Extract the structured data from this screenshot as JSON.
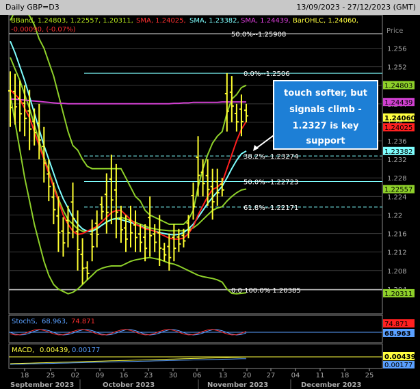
{
  "header": {
    "symbol": "Daily GBP=D3",
    "range": "13/09/2023 - 27/12/2023 (GMT)"
  },
  "legend": {
    "bband": "BBand, 1.24803, 1.22557, 1.20311,",
    "sma1": "SMA, 1.24025,",
    "sma2": "SMA, 1.23382,",
    "sma3": "SMA, 1.24439,",
    "ohlc": "BarOHLC, 1.24060,",
    "ohlc2": "-0.00090, (-0.07%)"
  },
  "axis": {
    "price_title": "Price",
    "ticks": [
      "1.256",
      "1.252",
      "1.248",
      "1.244",
      "1.24",
      "1.236",
      "1.232",
      "1.228",
      "1.224",
      "1.22",
      "1.216",
      "1.212",
      "1.208",
      "1.204"
    ],
    "days": [
      "18",
      "25",
      "02",
      "09",
      "16",
      "23",
      "30",
      "06",
      "13",
      "20",
      "27",
      "04",
      "11",
      "18",
      "25"
    ],
    "months": [
      "September 2023",
      "October 2023",
      "November 2023",
      "December 2023"
    ]
  },
  "tags": {
    "bb_upper": "1.24803",
    "sma_magenta": "1.24439",
    "last": "1.24060",
    "sma_red": "1.24025",
    "sma_cyan": "1.23382",
    "bb_mid": "1.22557",
    "bb_lower": "1.20311"
  },
  "fib": {
    "top": "50.0%--1.25908",
    "f0": "0.0%--1.2506",
    "f38": "38.2%--1.23274",
    "f50": "50.0%--1.22723",
    "f61": "61.8%--1.22171",
    "f100": "0.0 100.0% 1.20385"
  },
  "callout": "touch softer, but signals climb - 1.2327 is key support",
  "stoch": {
    "label": "StochS,",
    "v1": "68.963,",
    "v2": "74.871",
    "tag1": "74.871",
    "tag2": "68.963"
  },
  "macd": {
    "label": "MACD,",
    "v1": "0.00439,",
    "v2": "0.00177",
    "tag1": "0.00439",
    "tag2": "0.00177"
  },
  "chart_data": {
    "type": "line",
    "title": "Daily GBP=D3",
    "x": [
      "09-12",
      "09-13",
      "09-14",
      "09-15",
      "09-18",
      "09-19",
      "09-20",
      "09-21",
      "09-22",
      "09-25",
      "09-26",
      "09-27",
      "09-28",
      "09-29",
      "10-02",
      "10-03",
      "10-04",
      "10-05",
      "10-06",
      "10-09",
      "10-10",
      "10-11",
      "10-12",
      "10-13",
      "10-16",
      "10-17",
      "10-18",
      "10-19",
      "10-20",
      "10-23",
      "10-24",
      "10-25",
      "10-26",
      "10-27",
      "10-30",
      "10-31",
      "11-01",
      "11-02",
      "11-03",
      "11-06",
      "11-07",
      "11-08",
      "11-09",
      "11-10",
      "11-13",
      "11-14",
      "11-15",
      "11-16",
      "11-17",
      "11-20"
    ],
    "series": [
      {
        "name": "BarOHLC high",
        "values": [
          1.251,
          1.2505,
          1.249,
          1.248,
          1.247,
          1.243,
          1.244,
          1.239,
          1.232,
          1.227,
          1.224,
          1.2195,
          1.222,
          1.227,
          1.221,
          1.215,
          1.21,
          1.219,
          1.221,
          1.224,
          1.229,
          1.233,
          1.231,
          1.222,
          1.22,
          1.222,
          1.221,
          1.218,
          1.218,
          1.224,
          1.218,
          1.22,
          1.214,
          1.216,
          1.218,
          1.217,
          1.217,
          1.22,
          1.227,
          1.237,
          1.232,
          1.232,
          1.23,
          1.23,
          1.228,
          1.2506,
          1.25,
          1.244,
          1.246,
          1.244
        ]
      },
      {
        "name": "BarOHLC low",
        "values": [
          1.239,
          1.2395,
          1.238,
          1.237,
          1.234,
          1.235,
          1.232,
          1.227,
          1.223,
          1.218,
          1.212,
          1.211,
          1.213,
          1.215,
          1.208,
          1.205,
          1.206,
          1.21,
          1.213,
          1.219,
          1.216,
          1.218,
          1.215,
          1.214,
          1.212,
          1.213,
          1.212,
          1.212,
          1.21,
          1.211,
          1.212,
          1.209,
          1.21,
          1.208,
          1.21,
          1.212,
          1.213,
          1.215,
          1.219,
          1.224,
          1.224,
          1.222,
          1.219,
          1.222,
          1.224,
          1.238,
          1.24,
          1.238,
          1.237,
          1.24
        ]
      },
      {
        "name": "SMA 1.24025",
        "values": [
          1.247,
          1.246,
          1.245,
          1.243,
          1.241,
          1.238,
          1.235,
          1.232,
          1.229,
          1.226,
          1.223,
          1.22,
          1.218,
          1.2165,
          1.2158,
          1.216,
          1.2165,
          1.217,
          1.2175,
          1.2185,
          1.2195,
          1.2205,
          1.221,
          1.221,
          1.22,
          1.219,
          1.218,
          1.2175,
          1.217,
          1.2168,
          1.2165,
          1.216,
          1.2155,
          1.215,
          1.2148,
          1.2148,
          1.215,
          1.216,
          1.2175,
          1.22,
          1.222,
          1.224,
          1.2255,
          1.226,
          1.227,
          1.23,
          1.233,
          1.236,
          1.2385,
          1.2402
        ]
      },
      {
        "name": "SMA 1.23382",
        "values": [
          1.2575,
          1.255,
          1.252,
          1.249,
          1.2455,
          1.242,
          1.2385,
          1.235,
          1.232,
          1.229,
          1.226,
          1.2235,
          1.2215,
          1.2195,
          1.218,
          1.217,
          1.2165,
          1.2165,
          1.217,
          1.2178,
          1.2185,
          1.219,
          1.2192,
          1.219,
          1.2187,
          1.2184,
          1.218,
          1.2176,
          1.2172,
          1.2168,
          1.2165,
          1.2162,
          1.216,
          1.2158,
          1.2157,
          1.2158,
          1.2162,
          1.217,
          1.218,
          1.2195,
          1.221,
          1.2225,
          1.2238,
          1.225,
          1.2262,
          1.228,
          1.23,
          1.2318,
          1.2332,
          1.2338
        ]
      },
      {
        "name": "SMA 1.24439",
        "values": [
          1.245,
          1.245,
          1.2449,
          1.2448,
          1.2447,
          1.2446,
          1.2445,
          1.2444,
          1.2443,
          1.2442,
          1.2441,
          1.2441,
          1.244,
          1.244,
          1.244,
          1.244,
          1.244,
          1.244,
          1.244,
          1.244,
          1.244,
          1.244,
          1.244,
          1.244,
          1.244,
          1.244,
          1.244,
          1.244,
          1.244,
          1.244,
          1.244,
          1.244,
          1.244,
          1.244,
          1.2441,
          1.2441,
          1.2442,
          1.2442,
          1.2443,
          1.2443,
          1.2443,
          1.2443,
          1.2443,
          1.2443,
          1.2444,
          1.2444,
          1.2444,
          1.2444,
          1.2444,
          1.2444
        ]
      },
      {
        "name": "BBand upper",
        "values": [
          1.262,
          1.264,
          1.265,
          1.264,
          1.263,
          1.261,
          1.258,
          1.256,
          1.253,
          1.25,
          1.246,
          1.242,
          1.238,
          1.235,
          1.234,
          1.232,
          1.2305,
          1.23,
          1.23,
          1.23,
          1.23,
          1.23,
          1.23,
          1.23,
          1.228,
          1.226,
          1.224,
          1.223,
          1.221,
          1.22,
          1.2195,
          1.219,
          1.2185,
          1.218,
          1.218,
          1.218,
          1.218,
          1.219,
          1.221,
          1.226,
          1.23,
          1.233,
          1.2355,
          1.237,
          1.238,
          1.242,
          1.245,
          1.246,
          1.2475,
          1.248
        ]
      },
      {
        "name": "BBand middle",
        "values": [
          1.254,
          1.2515,
          1.249,
          1.246,
          1.243,
          1.2395,
          1.236,
          1.2325,
          1.2295,
          1.2265,
          1.2235,
          1.221,
          1.219,
          1.218,
          1.217,
          1.2165,
          1.2165,
          1.2168,
          1.2172,
          1.2178,
          1.2184,
          1.219,
          1.2193,
          1.2195,
          1.2192,
          1.2188,
          1.2184,
          1.218,
          1.2176,
          1.2172,
          1.217,
          1.2168,
          1.2167,
          1.2166,
          1.2166,
          1.2166,
          1.2166,
          1.2168,
          1.2172,
          1.218,
          1.219,
          1.22,
          1.221,
          1.2215,
          1.2218,
          1.223,
          1.224,
          1.2248,
          1.2254,
          1.2256
        ]
      },
      {
        "name": "BBand lower",
        "values": [
          1.246,
          1.24,
          1.234,
          1.228,
          1.223,
          1.218,
          1.214,
          1.21,
          1.207,
          1.205,
          1.204,
          1.2035,
          1.203,
          1.2033,
          1.204,
          1.205,
          1.206,
          1.207,
          1.208,
          1.2085,
          1.2088,
          1.209,
          1.209,
          1.209,
          1.2095,
          1.21,
          1.2103,
          1.2105,
          1.2107,
          1.2108,
          1.2106,
          1.2104,
          1.21,
          1.2096,
          1.2094,
          1.209,
          1.2085,
          1.208,
          1.2075,
          1.207,
          1.2067,
          1.2065,
          1.2063,
          1.206,
          1.2055,
          1.204,
          1.2031,
          1.203,
          1.2031,
          1.2032
        ]
      }
    ],
    "fib_levels": [
      1.25908,
      1.2506,
      1.23274,
      1.22723,
      1.22171,
      1.20385
    ],
    "ylim": [
      1.2,
      1.2605
    ]
  }
}
